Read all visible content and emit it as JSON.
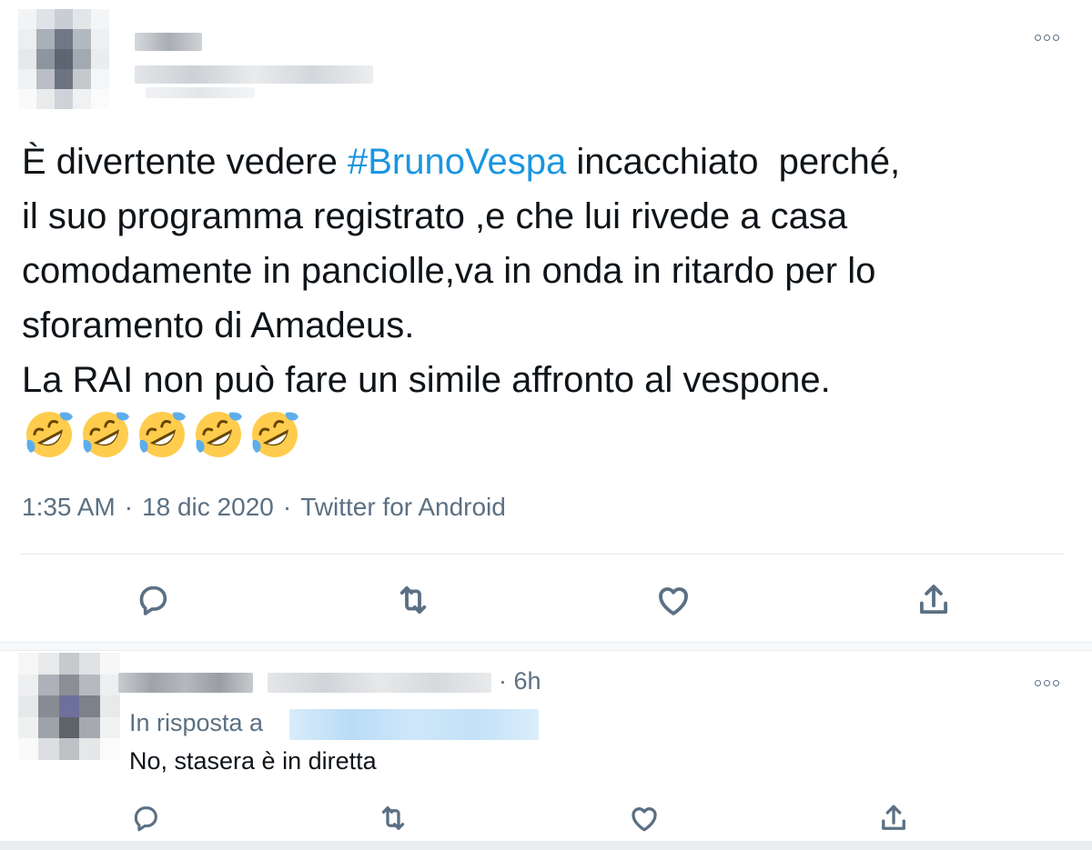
{
  "tweet": {
    "text_before": "È divertente vedere ",
    "hashtag": "#BrunoVespa",
    "text_after": " incacchiato  perché,\nil suo programma registrato ,e che lui rivede a casa\ncomodamente in panciolle,va in onda in ritardo per lo\nsforamento di Amadeus.\nLa RAI non può fare un simile affronto al vespone.",
    "emoji": [
      "rolling-on-floor-laughing",
      "rolling-on-floor-laughing",
      "rolling-on-floor-laughing",
      "rolling-on-floor-laughing",
      "rolling-on-floor-laughing"
    ],
    "time": "1:35 AM",
    "date": "18 dic 2020",
    "source": "Twitter for Android",
    "dot": "·"
  },
  "actions": {
    "icons": [
      "reply-icon",
      "retweet-icon",
      "like-icon",
      "share-icon"
    ]
  },
  "reply": {
    "time": "· 6h",
    "replying_to": "In risposta a",
    "text": "No, stasera è in diretta"
  },
  "colors": {
    "text": "#0f1419",
    "secondary": "#5b7083",
    "link": "#1b95e0",
    "divider": "#e6ecf0"
  }
}
